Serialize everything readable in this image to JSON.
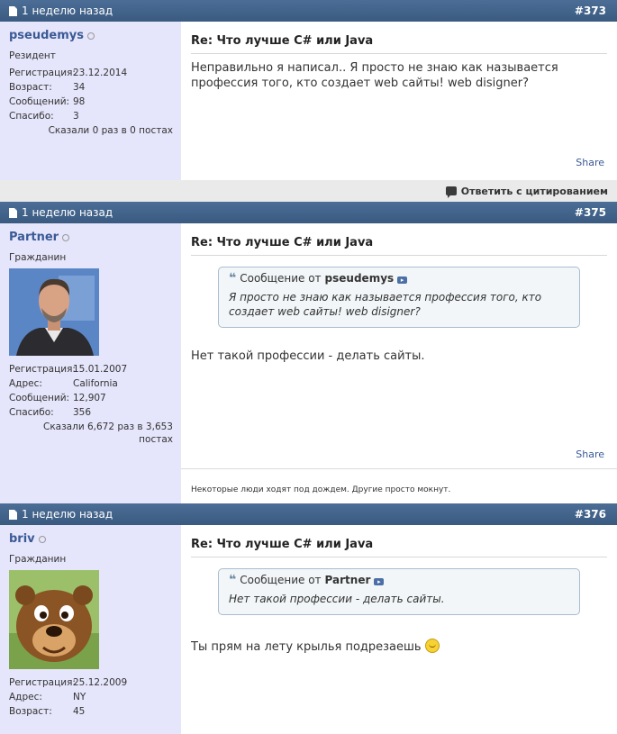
{
  "posts": [
    {
      "date": "1 неделю назад",
      "number": "#373",
      "username": "pseudemys",
      "usertitle": "Резидент",
      "stats": [
        {
          "label": "Регистрация:",
          "value": "23.12.2014"
        },
        {
          "label": "Возраст:",
          "value": "34"
        },
        {
          "label": "Сообщений:",
          "value": "98"
        },
        {
          "label": "Спасибо:",
          "value": "3"
        }
      ],
      "thanks_summary": "Сказали 0 раз в 0 постах",
      "title": "Re: Что лучше C# или Java",
      "message": "Неправильно я написал.. Я просто не знаю как называется профессия того, кто создает web сайты! web disigner?",
      "share": "Share",
      "reply_quote": "Ответить с цитированием"
    },
    {
      "date": "1 неделю назад",
      "number": "#375",
      "username": "Partner",
      "usertitle": "Гражданин",
      "stats": [
        {
          "label": "Регистрация:",
          "value": "15.01.2007"
        },
        {
          "label": "Адрес:",
          "value": "California"
        },
        {
          "label": "Сообщений:",
          "value": "12,907"
        },
        {
          "label": "Спасибо:",
          "value": "356"
        }
      ],
      "thanks_summary": "Сказали 6,672 раз в 3,653 постах",
      "title": "Re: Что лучше C# или Java",
      "quote_prefix": "Сообщение от",
      "quote_author": "pseudemys",
      "quote_text": "Я просто не знаю как называется профессия того, кто создает web сайты! web disigner?",
      "message": "Нет такой профессии - делать сайты.",
      "share": "Share",
      "signature": "Некоторые люди ходят под дождем. Другие просто мокнут."
    },
    {
      "date": "1 неделю назад",
      "number": "#376",
      "username": "briv",
      "usertitle": "Гражданин",
      "stats": [
        {
          "label": "Регистрация:",
          "value": "25.12.2009"
        },
        {
          "label": "Адрес:",
          "value": "NY"
        },
        {
          "label": "Возраст:",
          "value": "45"
        }
      ],
      "title": "Re: Что лучше C# или Java",
      "quote_prefix": "Сообщение от",
      "quote_author": "Partner",
      "quote_text": "Нет такой профессии - делать сайты.",
      "message": "Ты прям на лету крылья подрезаешь"
    }
  ],
  "colors": {
    "header": "#3a5a80",
    "userinfo_bg": "#e5e5fb",
    "link": "#3a5a95",
    "quote_border": "#a9bcd0"
  },
  "icons": [
    "document-icon",
    "online-status-icon",
    "quote-icon",
    "goto-post-icon",
    "reply-with-quote-icon",
    "smiley-icon"
  ]
}
